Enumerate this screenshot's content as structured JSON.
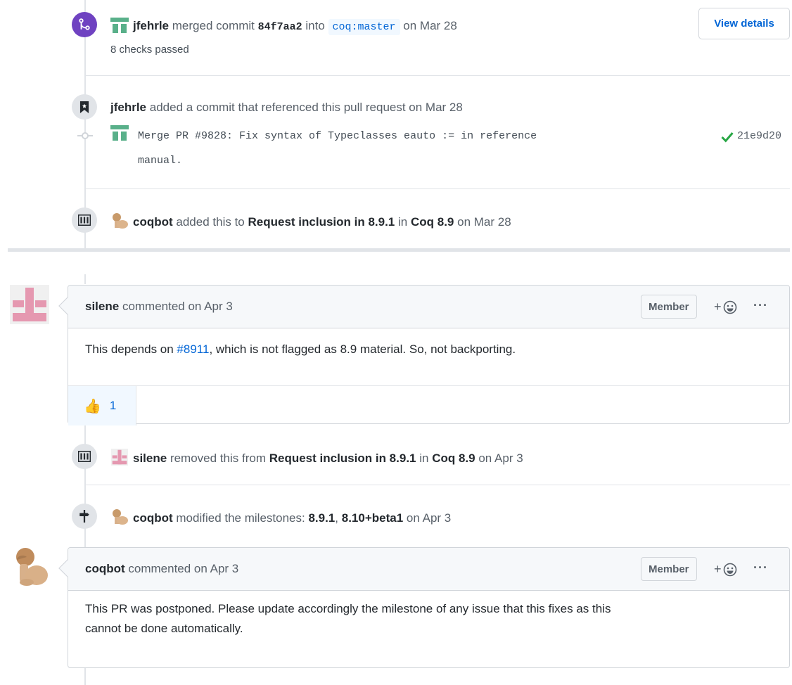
{
  "merge_event": {
    "user": "jfehrle",
    "action": "merged commit",
    "commit": "84f7aa2",
    "into": "into",
    "branch": "coq:master",
    "date": "on Mar 28",
    "checks": "8 checks passed",
    "view_details": "View details"
  },
  "ref_event": {
    "user": "jfehrle",
    "action": "added a commit that referenced this pull request on Mar 28",
    "commit_message_line1": "Merge PR #9828: Fix syntax of Typeclasses eauto := in reference",
    "commit_message_line2": "manual.",
    "commit_sha": "21e9d20"
  },
  "project_add_event": {
    "user": "coqbot",
    "action": "added this to",
    "column": "Request inclusion in 8.9.1",
    "in": "in",
    "project": "Coq 8.9",
    "date": "on Mar 28"
  },
  "comment1": {
    "author": "silene",
    "meta": "commented on Apr 3",
    "role": "Member",
    "body_before": "This depends on ",
    "link": "#8911",
    "body_after": ", which is not flagged as 8.9 material. So, not backporting.",
    "reaction_emoji": "👍",
    "reaction_count": "1"
  },
  "project_remove_event": {
    "user": "silene",
    "action": "removed this from",
    "column": "Request inclusion in 8.9.1",
    "in": "in",
    "project": "Coq 8.9",
    "date": "on Apr 3"
  },
  "milestone_event": {
    "user": "coqbot",
    "action": "modified the milestones:",
    "m1": "8.9.1",
    "sep": ",",
    "m2": "8.10+beta1",
    "date": "on Apr 3"
  },
  "comment2": {
    "author": "coqbot",
    "meta": "commented on Apr 3",
    "role": "Member",
    "body_line1": "This PR was postponed. Please update accordingly the milestone of any issue that this fixes as this",
    "body_line2": "cannot be done automatically."
  },
  "icons": {
    "merge": "git-merge-icon",
    "bookmark": "bookmark-icon",
    "project": "project-icon",
    "milestone": "milestone-icon",
    "check": "check-icon",
    "smiley": "smiley-icon",
    "more": "kebab-horizontal-icon"
  },
  "colors": {
    "merge_purple": "#6f42c1",
    "link_blue": "#0366d6",
    "check_green": "#28a745",
    "border": "#d1d5da"
  }
}
